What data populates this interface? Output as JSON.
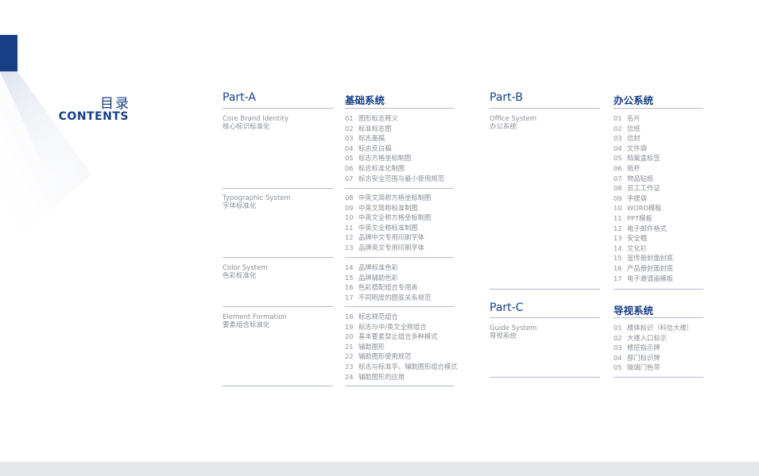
{
  "header": {
    "title_cn": "目录",
    "title_en": "CONTENTS"
  },
  "colors": {
    "brand": "#173f87",
    "line": "#b3b8cf",
    "text": "#8a8e99",
    "footer": "#e6e7ea"
  },
  "part_a": {
    "title": "Part-A",
    "system_title": "基础系统",
    "sections": [
      {
        "en": "Core Brand Identity",
        "cn": "核心标识标准化",
        "items": [
          {
            "num": "01",
            "label": "图形标志释义"
          },
          {
            "num": "02",
            "label": "标准标志图"
          },
          {
            "num": "03",
            "label": "标志墨稿"
          },
          {
            "num": "04",
            "label": "标志反白稿"
          },
          {
            "num": "05",
            "label": "标志方格坐标制图"
          },
          {
            "num": "06",
            "label": "标志标准化制图"
          },
          {
            "num": "07",
            "label": "标志安全范围与最小使用规范"
          }
        ]
      },
      {
        "en": "Typographic System",
        "cn": "字体标准化",
        "items": [
          {
            "num": "08",
            "label": "中英文简称方格坐标制图"
          },
          {
            "num": "09",
            "label": "中英文简称标准制图"
          },
          {
            "num": "10",
            "label": "中英文全称方格坐标制图"
          },
          {
            "num": "11",
            "label": "中英文全称标准制图"
          },
          {
            "num": "12",
            "label": "品牌中文专用印刷字体"
          },
          {
            "num": "13",
            "label": "品牌英文专用印刷字体"
          }
        ]
      },
      {
        "en": "Color System",
        "cn": "色彩标准化",
        "items": [
          {
            "num": "14",
            "label": "品牌标准色彩"
          },
          {
            "num": "15",
            "label": "品牌辅助色彩"
          },
          {
            "num": "16",
            "label": "色彩搭配组合专用表"
          },
          {
            "num": "17",
            "label": "不同明度的图底关系规范"
          }
        ]
      },
      {
        "en": "Element Formation",
        "cn": "要素组合标准化",
        "items": [
          {
            "num": "18",
            "label": "标志规范组合"
          },
          {
            "num": "19",
            "label": "标志与中/英文全称组合"
          },
          {
            "num": "20",
            "label": "基本要素禁止组合多种模式"
          },
          {
            "num": "21",
            "label": "辅助图形"
          },
          {
            "num": "22",
            "label": "辅助图形使用规范"
          },
          {
            "num": "23",
            "label": "标志与标准字、辅助图形组合模式"
          },
          {
            "num": "24",
            "label": "辅助图形的应用"
          }
        ]
      }
    ]
  },
  "part_b": {
    "title": "Part-B",
    "system_title": "办公系统",
    "section": {
      "en": "Office System",
      "cn": "办公系统",
      "items": [
        {
          "num": "01",
          "label": "名片"
        },
        {
          "num": "02",
          "label": "信纸"
        },
        {
          "num": "03",
          "label": "信封"
        },
        {
          "num": "04",
          "label": "文件袋"
        },
        {
          "num": "05",
          "label": "档案盒标签"
        },
        {
          "num": "06",
          "label": "纸杯"
        },
        {
          "num": "07",
          "label": "物品贴纸"
        },
        {
          "num": "08",
          "label": "员工工作证"
        },
        {
          "num": "09",
          "label": "手提袋"
        },
        {
          "num": "10",
          "label": "WORD模板"
        },
        {
          "num": "11",
          "label": "PPT模板"
        },
        {
          "num": "12",
          "label": "电子邮件格式"
        },
        {
          "num": "13",
          "label": "安全帽"
        },
        {
          "num": "14",
          "label": "文化衫"
        },
        {
          "num": "15",
          "label": "宣传册封面封底"
        },
        {
          "num": "16",
          "label": "产品册封面封底"
        },
        {
          "num": "17",
          "label": "电子邀请函模板"
        }
      ]
    }
  },
  "part_c": {
    "title": "Part-C",
    "system_title": "导视系统",
    "section": {
      "en": "Guide System",
      "cn": "导视系统",
      "items": [
        {
          "num": "01",
          "label": "楼体标识（科信大楼）"
        },
        {
          "num": "02",
          "label": "大楼入口标示"
        },
        {
          "num": "03",
          "label": "楼层指示牌"
        },
        {
          "num": "04",
          "label": "部门标识牌"
        },
        {
          "num": "05",
          "label": "玻璃门色带"
        }
      ]
    }
  }
}
